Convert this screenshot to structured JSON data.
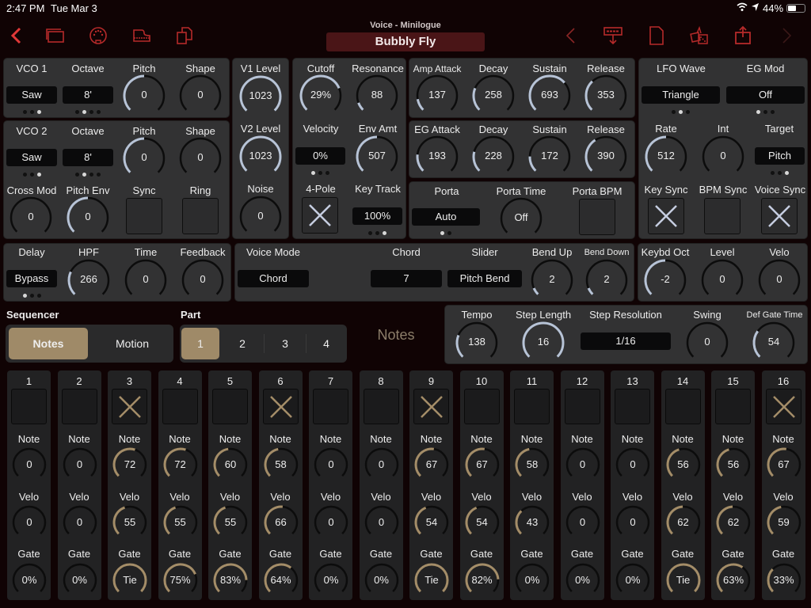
{
  "status_bar": {
    "time": "2:47 PM",
    "date": "Tue Mar 3",
    "battery": "44%"
  },
  "header": {
    "subtitle": "Voice - Minilogue",
    "title": "Bubbly Fly"
  },
  "toolbar_left": [
    "back-icon",
    "windows-icon",
    "midi-icon",
    "piano-icon",
    "copy-docs-icon"
  ],
  "toolbar_right": [
    "previous-icon",
    "download-preset-icon",
    "new-document-icon",
    "dice-random-icon",
    "share-icon",
    "next-icon"
  ],
  "colors": {
    "accent_red": "#d03434",
    "knob_arc": "#b7c3d6",
    "step_arc": "#a48d68",
    "seg_active": "#9f8a68"
  },
  "vco1": {
    "label": "VCO 1",
    "wave": "Saw",
    "octave_label": "Octave",
    "octave": "8'",
    "pitch_label": "Pitch",
    "pitch": "0",
    "pitch_frac": 0.5,
    "shape_label": "Shape",
    "shape": "0",
    "shape_frac": 0
  },
  "vco2": {
    "label": "VCO 2",
    "wave": "Saw",
    "octave_label": "Octave",
    "octave": "8'",
    "pitch_label": "Pitch",
    "pitch": "0",
    "pitch_frac": 0.5,
    "shape_label": "Shape",
    "shape": "0",
    "shape_frac": 0,
    "cross_mod_label": "Cross Mod",
    "cross_mod": "0",
    "pitch_env_label": "Pitch Env",
    "pitch_env": "0",
    "sync_label": "Sync",
    "ring_label": "Ring"
  },
  "mixer": {
    "v1_label": "V1 Level",
    "v1": "1023",
    "v2_label": "V2 Level",
    "v2": "1023",
    "noise_label": "Noise",
    "noise": "0"
  },
  "filter": {
    "cutoff_label": "Cutoff",
    "cutoff": "29%",
    "resonance_label": "Resonance",
    "resonance": "88",
    "velocity_label": "Velocity",
    "velocity": "0%",
    "env_amt_label": "Env Amt",
    "env_amt": "507",
    "pole_label": "4-Pole",
    "key_track_label": "Key Track",
    "key_track": "100%"
  },
  "amp_eg": {
    "attack_label": "Amp Attack",
    "attack": "137",
    "decay_label": "Decay",
    "decay": "258",
    "sustain_label": "Sustain",
    "sustain": "693",
    "release_label": "Release",
    "release": "353"
  },
  "eg": {
    "attack_label": "EG Attack",
    "attack": "193",
    "decay_label": "Decay",
    "decay": "228",
    "sustain_label": "Sustain",
    "sustain": "172",
    "release_label": "Release",
    "release": "390"
  },
  "porta": {
    "porta_label": "Porta",
    "porta": "Auto",
    "time_label": "Porta Time",
    "time": "Off",
    "bpm_label": "Porta BPM"
  },
  "lfo": {
    "wave_label": "LFO Wave",
    "wave": "Triangle",
    "eg_mod_label": "EG Mod",
    "eg_mod": "Off",
    "rate_label": "Rate",
    "rate": "512",
    "int_label": "Int",
    "int": "0",
    "target_label": "Target",
    "target": "Pitch",
    "key_sync_label": "Key Sync",
    "bpm_sync_label": "BPM Sync",
    "voice_sync_label": "Voice Sync"
  },
  "delay": {
    "label": "Delay",
    "mode": "Bypass",
    "hpf_label": "HPF",
    "hpf": "266",
    "time_label": "Time",
    "time": "0",
    "feedback_label": "Feedback",
    "feedback": "0"
  },
  "voice": {
    "mode_label": "Voice Mode",
    "mode": "Chord",
    "chord_label": "Chord",
    "chord": "7",
    "slider_label": "Slider",
    "slider": "Pitch Bend",
    "bend_up_label": "Bend Up",
    "bend_up": "2",
    "bend_down_label": "Bend Down",
    "bend_down": "2"
  },
  "keyboard": {
    "oct_label": "Keybd Oct",
    "oct": "-2",
    "level_label": "Level",
    "level": "0",
    "velo_label": "Velo",
    "velo": "0"
  },
  "sequencer": {
    "label": "Sequencer",
    "modes": [
      "Notes",
      "Motion"
    ],
    "active_mode": 0,
    "part_label": "Part",
    "parts": [
      "1",
      "2",
      "3",
      "4"
    ],
    "active_part": 0,
    "view_label": "Notes"
  },
  "seq_settings": {
    "tempo_label": "Tempo",
    "tempo": "138",
    "step_length_label": "Step Length",
    "step_length": "16",
    "step_res_label": "Step Resolution",
    "step_res": "1/16",
    "swing_label": "Swing",
    "swing": "0",
    "gate_label": "Def Gate Time",
    "gate": "54"
  },
  "steps": [
    {
      "n": "1",
      "on": false,
      "note": "0",
      "velo": "0",
      "gate": "0%",
      "nf": 0,
      "vf": 0,
      "gf": 0
    },
    {
      "n": "2",
      "on": false,
      "note": "0",
      "velo": "0",
      "gate": "0%",
      "nf": 0,
      "vf": 0,
      "gf": 0
    },
    {
      "n": "3",
      "on": true,
      "note": "72",
      "velo": "55",
      "gate": "Tie",
      "nf": 0.57,
      "vf": 0.43,
      "gf": 1
    },
    {
      "n": "4",
      "on": false,
      "note": "72",
      "velo": "55",
      "gate": "75%",
      "nf": 0.57,
      "vf": 0.43,
      "gf": 0.75
    },
    {
      "n": "5",
      "on": false,
      "note": "60",
      "velo": "55",
      "gate": "83%",
      "nf": 0.47,
      "vf": 0.43,
      "gf": 0.83
    },
    {
      "n": "6",
      "on": true,
      "note": "58",
      "velo": "66",
      "gate": "64%",
      "nf": 0.46,
      "vf": 0.52,
      "gf": 0.64
    },
    {
      "n": "7",
      "on": false,
      "note": "0",
      "velo": "0",
      "gate": "0%",
      "nf": 0,
      "vf": 0,
      "gf": 0
    },
    {
      "n": "8",
      "on": false,
      "note": "0",
      "velo": "0",
      "gate": "0%",
      "nf": 0,
      "vf": 0,
      "gf": 0
    },
    {
      "n": "9",
      "on": true,
      "note": "67",
      "velo": "54",
      "gate": "Tie",
      "nf": 0.53,
      "vf": 0.42,
      "gf": 1
    },
    {
      "n": "10",
      "on": false,
      "note": "67",
      "velo": "54",
      "gate": "82%",
      "nf": 0.53,
      "vf": 0.42,
      "gf": 0.82
    },
    {
      "n": "11",
      "on": false,
      "note": "58",
      "velo": "43",
      "gate": "0%",
      "nf": 0.46,
      "vf": 0.34,
      "gf": 0
    },
    {
      "n": "12",
      "on": false,
      "note": "0",
      "velo": "0",
      "gate": "0%",
      "nf": 0,
      "vf": 0,
      "gf": 0
    },
    {
      "n": "13",
      "on": false,
      "note": "0",
      "velo": "0",
      "gate": "0%",
      "nf": 0,
      "vf": 0,
      "gf": 0
    },
    {
      "n": "14",
      "on": false,
      "note": "56",
      "velo": "62",
      "gate": "Tie",
      "nf": 0.44,
      "vf": 0.49,
      "gf": 1
    },
    {
      "n": "15",
      "on": false,
      "note": "56",
      "velo": "62",
      "gate": "63%",
      "nf": 0.44,
      "vf": 0.49,
      "gf": 0.63
    },
    {
      "n": "16",
      "on": true,
      "note": "67",
      "velo": "59",
      "gate": "33%",
      "nf": 0.53,
      "vf": 0.46,
      "gf": 0.33
    }
  ],
  "step_labels": {
    "note": "Note",
    "velo": "Velo",
    "gate": "Gate"
  }
}
